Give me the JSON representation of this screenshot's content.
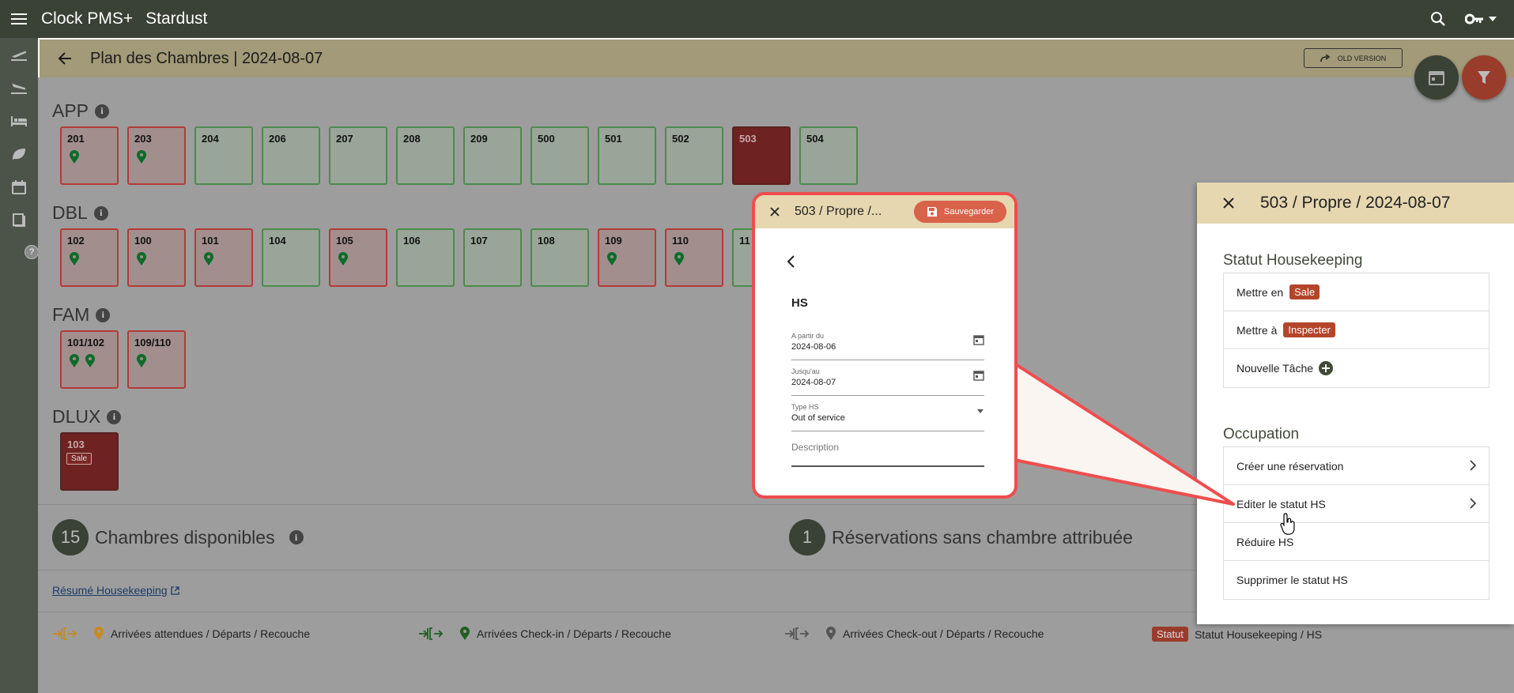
{
  "app": {
    "name": "Clock PMS+",
    "hotel": "Stardust"
  },
  "header": {
    "title": "Plan des Chambres | 2024-08-07",
    "old_version": "OLD VERSION"
  },
  "categories": [
    {
      "name": "APP",
      "rooms": [
        {
          "num": "201",
          "pins": 1,
          "occ": true
        },
        {
          "num": "203",
          "pins": 1,
          "occ": true
        },
        {
          "num": "204"
        },
        {
          "num": "206"
        },
        {
          "num": "207"
        },
        {
          "num": "208"
        },
        {
          "num": "209"
        },
        {
          "num": "500"
        },
        {
          "num": "501"
        },
        {
          "num": "502"
        },
        {
          "num": "503",
          "hs": true
        },
        {
          "num": "504"
        }
      ]
    },
    {
      "name": "DBL",
      "rooms": [
        {
          "num": "102",
          "pins": 1,
          "occ": true
        },
        {
          "num": "100",
          "pins": 1,
          "occ": true
        },
        {
          "num": "101",
          "pins": 1,
          "occ": true
        },
        {
          "num": "104"
        },
        {
          "num": "105",
          "pins": 1,
          "occ": true
        },
        {
          "num": "106"
        },
        {
          "num": "107"
        },
        {
          "num": "108"
        },
        {
          "num": "109",
          "pins": 1,
          "occ": true
        },
        {
          "num": "110",
          "pins": 1,
          "occ": true
        },
        {
          "num": "11"
        }
      ]
    },
    {
      "name": "FAM",
      "rooms": [
        {
          "num": "101/102",
          "pins": 2,
          "occ": true
        },
        {
          "num": "109/110",
          "pins": 1,
          "occ": true
        }
      ]
    },
    {
      "name": "DLUX",
      "rooms": [
        {
          "num": "103",
          "hs": true,
          "badge": "Sale"
        }
      ]
    }
  ],
  "summary": {
    "available_count": "15",
    "available_label": "Chambres disponibles",
    "unassigned_count": "1",
    "unassigned_label": "Réservations sans chambre attribuée"
  },
  "housekeeping_link": "Résumé Housekeeping",
  "legend": [
    {
      "label": "Arrivées attendues / Départs / Recouche",
      "color": "#c8891f"
    },
    {
      "label": "Arrivées Check-in / Départs / Recouche",
      "color": "#1f5f1f"
    },
    {
      "label": "Arrivées Check-out / Départs / Recouche",
      "color": "#555555"
    },
    {
      "label": "Statut Housekeeping / HS",
      "tag": "Statut"
    }
  ],
  "panel": {
    "title": "503 / Propre / 2024-08-07",
    "hk_heading": "Statut Housekeeping",
    "hk_items": [
      {
        "label": "Mettre en",
        "tag": "Sale"
      },
      {
        "label": "Mettre à",
        "tag": "Inspecter"
      },
      {
        "label": "Nouvelle Tâche"
      }
    ],
    "occ_heading": "Occupation",
    "occ_items": [
      {
        "label": "Créer une réservation"
      },
      {
        "label": "Editer le statut HS"
      },
      {
        "label": "Réduire HS"
      },
      {
        "label": "Supprimer le statut HS"
      }
    ]
  },
  "popup": {
    "title": "503 / Propre /...",
    "save": "Sauvegarder",
    "heading": "HS",
    "from_label": "A partir du",
    "from_value": "2024-08-06",
    "to_label": "Jusqu'au",
    "to_value": "2024-08-07",
    "type_label": "Type HS",
    "type_value": "Out of service",
    "description_placeholder": "Description"
  },
  "colors": {
    "accent": "#b4452b",
    "topbar": "#3a4135",
    "header": "#a29a78",
    "callout": "#ef4d4d"
  }
}
